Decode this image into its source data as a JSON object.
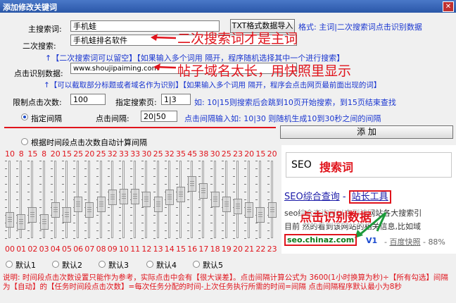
{
  "window": {
    "title": "添加修改关键词"
  },
  "main_keyword": {
    "label": "主搜索词:",
    "value": "手机蛙",
    "import_button": "TXT格式数据导入",
    "format_hint": "格式: 主词|二次搜索词点击识别数据"
  },
  "secondary_keyword": {
    "label": "二次搜索:",
    "value": "手机蛙排名软件",
    "note": "二次搜索词才是主词"
  },
  "hint_line_1": "↑【二次搜索词可以留空】【如果输入多个词用  隔开，程序随机选择其中一个进行搜索】",
  "click_data": {
    "label": "点击识别数据:",
    "value": "www.shoujipaiming.com",
    "note": "帖子域名太长，用快照里显示"
  },
  "hint_line_2": "↑【可以截取部分标题或者域名作为识别】【如果输入多个词用  隔开，程序会点击网页最前面出现的词】",
  "limit_clicks": {
    "label": "限制点击次数:",
    "value": "100"
  },
  "search_pages": {
    "label": "指定搜索页:",
    "value": "1|3",
    "hint": "如: 10|15则搜索后会跳到10页开始搜索，到15页结束查找"
  },
  "interval_mode": {
    "fixed_label": "指定间隔",
    "fixed_selected": true,
    "interval_label": "点击间隔:",
    "interval_value": "20|50",
    "interval_hint": "点击间隔输入如: 10|30 则随机生成10到30秒之间的间隔"
  },
  "auto_mode": {
    "label": "根据时间段点击次数自动计算间隔",
    "selected": false
  },
  "add_button": "添 加",
  "hour_sliders": {
    "values": [
      10,
      8,
      15,
      8,
      20,
      15,
      25,
      20,
      25,
      32,
      33,
      33,
      30,
      25,
      32,
      35,
      45,
      38,
      30,
      25,
      23,
      20,
      15,
      20
    ],
    "hours": [
      "00",
      "01",
      "02",
      "03",
      "04",
      "05",
      "06",
      "07",
      "08",
      "09",
      "10",
      "11",
      "12",
      "13",
      "14",
      "15",
      "16",
      "17",
      "18",
      "19",
      "20",
      "21",
      "22",
      "23"
    ]
  },
  "presets": [
    "默认1",
    "默认2",
    "默认3",
    "默认4",
    "默认5"
  ],
  "preview": {
    "search_box_text": "SEO",
    "search_box_label": "搜索词",
    "result_title_1": "SEO综合查询",
    "result_title_sep": " - ",
    "result_title_2": "站长工具",
    "snippet_1": "seo综合查询可以查到该网站各大搜索引",
    "snippet_2": "目前 然的看到该网站的相关信息,比如域",
    "overlay_label": "点击识别数据",
    "url": "seo.chinaz.com",
    "badge": "V1",
    "snapshot": "百度快照",
    "percent": "88%"
  },
  "footer_note": "说明: 时间段点击次数设置只能作为参考，实际点击中会有【很大误差】。点击间隔计算公式为 3600(1小时换算为秒)÷【所有勾选】间隔为【自动】的【任务时间段点击次数】=每次任务分配的时间-上次任务执行所需的时间=间隔 点击间隔程序默认最小为8秒"
}
